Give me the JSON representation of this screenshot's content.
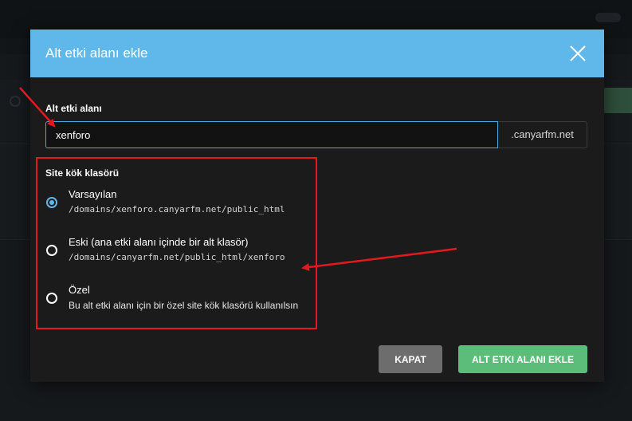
{
  "modal": {
    "title": "Alt etki alanı ekle",
    "subdomain_label": "Alt etki alanı",
    "subdomain_value": "xenforo",
    "domain_suffix": ".canyarfm.net",
    "root_label": "Site kök klasörü",
    "options": [
      {
        "title": "Varsayılan",
        "detail": "/domains/xenforo.canyarfm.net/public_html",
        "selected": true
      },
      {
        "title": "Eski (ana etki alanı içinde bir alt klasör)",
        "detail": "/domains/canyarfm.net/public_html/xenforo",
        "selected": false
      },
      {
        "title": "Özel",
        "detail": "Bu alt etki alanı için bir özel site kök klasörü kullanılsın",
        "selected": false
      }
    ],
    "close_button": "KAPAT",
    "add_button": "ALT ETKI ALANI EKLE"
  },
  "colors": {
    "header": "#5fb7ea",
    "add_button": "#5cbd7b",
    "close_button": "#6d6d6d",
    "annotation": "#e3191f"
  },
  "icons": {
    "close": "close-icon"
  }
}
